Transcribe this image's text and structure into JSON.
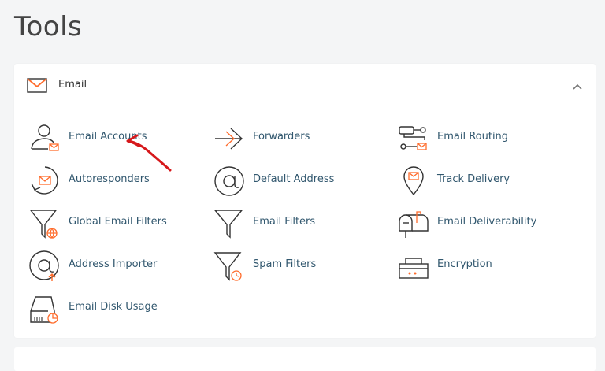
{
  "page": {
    "title": "Tools"
  },
  "section": {
    "title": "Email",
    "icon": "envelope-icon",
    "collapse_icon": "chevron-up-icon",
    "accent_color": "#ff6c2c",
    "link_color": "#31576e"
  },
  "tools": [
    {
      "label": "Email Accounts",
      "icon": "user-envelope-icon"
    },
    {
      "label": "Forwarders",
      "icon": "forward-arrow-icon"
    },
    {
      "label": "Email Routing",
      "icon": "routing-icon"
    },
    {
      "label": "Autoresponders",
      "icon": "autoresponder-icon"
    },
    {
      "label": "Default Address",
      "icon": "at-sign-icon"
    },
    {
      "label": "Track Delivery",
      "icon": "location-pin-envelope-icon"
    },
    {
      "label": "Global Email Filters",
      "icon": "filter-globe-icon"
    },
    {
      "label": "Email Filters",
      "icon": "filter-icon"
    },
    {
      "label": "Email Deliverability",
      "icon": "mailbox-icon"
    },
    {
      "label": "Address Importer",
      "icon": "at-import-icon"
    },
    {
      "label": "Spam Filters",
      "icon": "filter-clock-icon"
    },
    {
      "label": "Encryption",
      "icon": "encryption-box-icon"
    },
    {
      "label": "Email Disk Usage",
      "icon": "disk-usage-icon"
    }
  ]
}
